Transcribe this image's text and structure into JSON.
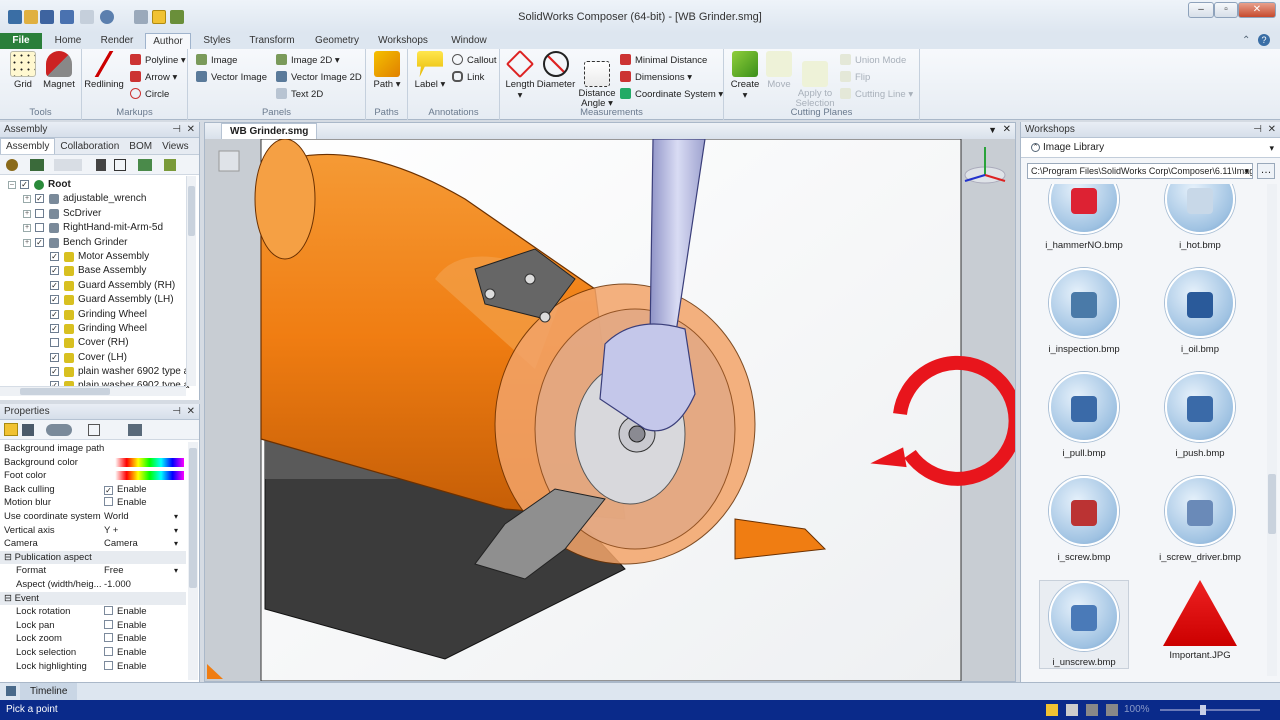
{
  "window": {
    "title": "SolidWorks Composer (64-bit) - [WB Grinder.smg]"
  },
  "tabs": [
    "Home",
    "Render",
    "Author",
    "Styles",
    "Transform",
    "Geometry",
    "Workshops",
    "Window"
  ],
  "file_tab": "File",
  "ribbon": {
    "tools": {
      "grid": "Grid",
      "magnet": "Magnet",
      "label": "Tools"
    },
    "markups": {
      "redlining": "Redlining",
      "polyline": "Polyline",
      "arrow": "Arrow",
      "circle": "Circle",
      "label": "Markups"
    },
    "panels": {
      "image": "Image",
      "vector_image": "Vector Image",
      "image_2d": "Image 2D",
      "vector_image_2d": "Vector Image 2D",
      "text_2d": "Text 2D",
      "label": "Panels"
    },
    "paths": {
      "path": "Path",
      "label": "Paths"
    },
    "annotations": {
      "label_btn": "Label",
      "callout": "Callout",
      "link": "Link",
      "label": "Annotations"
    },
    "measurements": {
      "length": "Length",
      "diameter": "Diameter",
      "distance_angle": "Distance\nAngle",
      "minimal_distance": "Minimal Distance",
      "dimensions": "Dimensions",
      "coordinate_system": "Coordinate System",
      "label": "Measurements"
    },
    "cutting": {
      "create": "Create",
      "move": "Move",
      "apply": "Apply to\nSelection",
      "union_mode": "Union Mode",
      "flip": "Flip",
      "cutting_line": "Cutting Line",
      "label": "Cutting Planes"
    }
  },
  "assembly": {
    "title": "Assembly",
    "subtabs": [
      "Assembly",
      "Collaboration",
      "BOM",
      "Views"
    ],
    "tree": [
      {
        "label": "Root",
        "indent": 0,
        "checked": true,
        "bold": true
      },
      {
        "label": "adjustable_wrench",
        "indent": 1,
        "checked": true
      },
      {
        "label": "ScDriver",
        "indent": 1,
        "checked": false
      },
      {
        "label": "RightHand-mit-Arm-5d",
        "indent": 1,
        "checked": false
      },
      {
        "label": "Bench Grinder",
        "indent": 1,
        "checked": true
      },
      {
        "label": "Motor Assembly",
        "indent": 2,
        "checked": true
      },
      {
        "label": "Base Assembly",
        "indent": 2,
        "checked": true
      },
      {
        "label": "Guard Assembly (RH)",
        "indent": 2,
        "checked": true
      },
      {
        "label": "Guard Assembly (LH)",
        "indent": 2,
        "checked": true
      },
      {
        "label": "Grinding Wheel",
        "indent": 2,
        "checked": true
      },
      {
        "label": "Grinding Wheel",
        "indent": 2,
        "checked": true
      },
      {
        "label": "Cover (RH)",
        "indent": 2,
        "checked": false
      },
      {
        "label": "Cover (LH)",
        "indent": 2,
        "checked": true
      },
      {
        "label": "plain washer 6902 type a",
        "indent": 2,
        "checked": true
      },
      {
        "label": "plain washer 6902 type a",
        "indent": 2,
        "checked": true
      }
    ]
  },
  "properties": {
    "title": "Properties",
    "rows": [
      {
        "k": "Background image path",
        "v": ""
      },
      {
        "k": "Background color",
        "v": ""
      },
      {
        "k": "Foot color",
        "v": ""
      },
      {
        "k": "Back culling",
        "v": "Enable",
        "chk": true
      },
      {
        "k": "Motion blur",
        "v": "Enable",
        "chk": false
      },
      {
        "k": "Use coordinate system",
        "v": "World"
      },
      {
        "k": "Vertical axis",
        "v": "Y +"
      },
      {
        "k": "Camera",
        "v": "Camera"
      },
      {
        "k": "Publication aspect",
        "v": "",
        "sect": true
      },
      {
        "k": "Format",
        "v": "Free"
      },
      {
        "k": "Aspect (width/heig...",
        "v": "-1.000"
      },
      {
        "k": "Event",
        "v": "",
        "sect": true
      },
      {
        "k": "Lock rotation",
        "v": "Enable",
        "chk": false
      },
      {
        "k": "Lock pan",
        "v": "Enable",
        "chk": false
      },
      {
        "k": "Lock zoom",
        "v": "Enable",
        "chk": false
      },
      {
        "k": "Lock selection",
        "v": "Enable",
        "chk": false
      },
      {
        "k": "Lock highlighting",
        "v": "Enable",
        "chk": false
      }
    ]
  },
  "document": {
    "tab": "WB Grinder.smg"
  },
  "workshops": {
    "title": "Workshops",
    "library": "Image Library",
    "path": "C:\\Program Files\\SolidWorks Corp\\Composer\\6.11\\Imag",
    "items": [
      "i_hammerNO.bmp",
      "i_hot.bmp",
      "i_inspection.bmp",
      "i_oil.bmp",
      "i_pull.bmp",
      "i_push.bmp",
      "i_screw.bmp",
      "i_screw_driver.bmp",
      "i_unscrew.bmp",
      "Important.JPG"
    ]
  },
  "timeline": {
    "label": "Timeline"
  },
  "status": {
    "text": "Pick a point",
    "zoom": "100%"
  },
  "colors": {
    "orange": "#f07d12",
    "file_green": "#2a7f3a",
    "status_blue": "#0a2a8a",
    "arrow_red": "#e8151c"
  }
}
